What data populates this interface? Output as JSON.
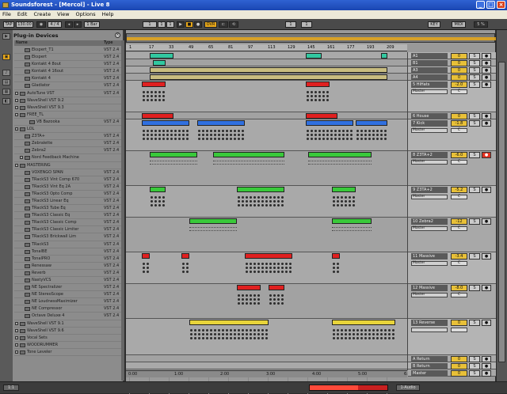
{
  "window": {
    "title": "Soundsforest - [Mercol] - Live 8",
    "buttons": [
      "_",
      "□",
      "×"
    ]
  },
  "menu": [
    "File",
    "Edit",
    "Create",
    "View",
    "Options",
    "Help"
  ],
  "toolbar": {
    "tap": "TAP",
    "tempo": "130.00",
    "sig": "4 / 4",
    "quant": "1 Bar",
    "follow": "OVR",
    "pos1": "1",
    "pos2": "1",
    "pos3": "1",
    "loop1": "1",
    "loop2": "1",
    "key": "KEY",
    "midi": "MIDI",
    "cpu": "5 %"
  },
  "browser": {
    "title": "Plug-in Devices",
    "col_name": "Name",
    "col_type": "Type",
    "icons": [
      "▶",
      "▣",
      "♪",
      "▤",
      "▦",
      "◧"
    ],
    "items": [
      {
        "name": "Ekspert_T1",
        "type": "VST 2.4",
        "kind": "plugin",
        "indent": 1
      },
      {
        "name": "Ekspert",
        "type": "VST 2.4",
        "kind": "plugin",
        "indent": 1
      },
      {
        "name": "Kontakt 4 8out",
        "type": "VST 2.4",
        "kind": "plugin",
        "indent": 1
      },
      {
        "name": "Kontakt 4 16out",
        "type": "VST 2.4",
        "kind": "plugin",
        "indent": 1
      },
      {
        "name": "Kontakt 4",
        "type": "VST 2.4",
        "kind": "plugin",
        "indent": 1
      },
      {
        "name": "Gladiator",
        "type": "VST 2.4",
        "kind": "plugin",
        "indent": 1
      },
      {
        "name": "AutoTune VST",
        "type": "VST 2.4",
        "kind": "folder",
        "indent": 0
      },
      {
        "name": "WaveShell VST 9.2",
        "type": "",
        "kind": "folder",
        "indent": 0
      },
      {
        "name": "WaveShell VST 9.3",
        "type": "",
        "kind": "folder",
        "indent": 0
      },
      {
        "name": "FREE_TL",
        "type": "",
        "kind": "folder",
        "indent": 0
      },
      {
        "name": "VB Bazooka",
        "type": "VST 2.4",
        "kind": "plugin",
        "indent": 2
      },
      {
        "name": "LOL",
        "type": "",
        "kind": "folder",
        "indent": 0
      },
      {
        "name": "Z3TA+",
        "type": "VST 2.4",
        "kind": "plugin",
        "indent": 1
      },
      {
        "name": "Zebralette",
        "type": "VST 2.4",
        "kind": "plugin",
        "indent": 1
      },
      {
        "name": "Zebra2",
        "type": "VST 2.4",
        "kind": "plugin",
        "indent": 1
      },
      {
        "name": "Nord Feedback Machine",
        "type": "",
        "kind": "folder",
        "indent": 1
      },
      {
        "name": "MASTERING",
        "type": "",
        "kind": "folder",
        "indent": 0
      },
      {
        "name": "VOXENGO SPAN",
        "type": "VST 2.4",
        "kind": "plugin",
        "indent": 1
      },
      {
        "name": "TRackS3 Vint Comp 670",
        "type": "VST 2.4",
        "kind": "plugin",
        "indent": 1
      },
      {
        "name": "TRackS3 Vint Eq 2A",
        "type": "VST 2.4",
        "kind": "plugin",
        "indent": 1
      },
      {
        "name": "TRackS3 Opto Comp",
        "type": "VST 2.4",
        "kind": "plugin",
        "indent": 1
      },
      {
        "name": "TRackS3 Linear Eq",
        "type": "VST 2.4",
        "kind": "plugin",
        "indent": 1
      },
      {
        "name": "TRackS3 Tube Eq",
        "type": "VST 2.4",
        "kind": "plugin",
        "indent": 1
      },
      {
        "name": "TRackS3 Classic Eq",
        "type": "VST 2.4",
        "kind": "plugin",
        "indent": 1
      },
      {
        "name": "TRackS3 Classic Comp",
        "type": "VST 2.4",
        "kind": "plugin",
        "indent": 1
      },
      {
        "name": "TRackS3 Classic Limiter",
        "type": "VST 2.4",
        "kind": "plugin",
        "indent": 1
      },
      {
        "name": "TRackS3 Brickwall Lim",
        "type": "VST 2.4",
        "kind": "plugin",
        "indent": 1
      },
      {
        "name": "TRackS3",
        "type": "VST 2.4",
        "kind": "plugin",
        "indent": 1
      },
      {
        "name": "TonalBE",
        "type": "VST 2.4",
        "kind": "plugin",
        "indent": 1
      },
      {
        "name": "TonalPRO",
        "type": "VST 2.4",
        "kind": "plugin",
        "indent": 1
      },
      {
        "name": "Renessaw",
        "type": "VST 2.4",
        "kind": "plugin",
        "indent": 1
      },
      {
        "name": "Reverb",
        "type": "VST 2.4",
        "kind": "plugin",
        "indent": 1
      },
      {
        "name": "NastyVCS",
        "type": "VST 2.4",
        "kind": "plugin",
        "indent": 1
      },
      {
        "name": "NE Spectralizer",
        "type": "VST 2.4",
        "kind": "plugin",
        "indent": 1
      },
      {
        "name": "NE StereoScope",
        "type": "VST 2.4",
        "kind": "plugin",
        "indent": 1
      },
      {
        "name": "NE LoudnessMaximizer",
        "type": "VST 2.4",
        "kind": "plugin",
        "indent": 1
      },
      {
        "name": "NE Compressor",
        "type": "VST 2.4",
        "kind": "plugin",
        "indent": 1
      },
      {
        "name": "Octave Deluxe 4",
        "type": "VST 2.4",
        "kind": "plugin",
        "indent": 1
      },
      {
        "name": "WaveShell VST 9.1",
        "type": "",
        "kind": "folder",
        "indent": 0
      },
      {
        "name": "WaveShell VST 9.6",
        "type": "",
        "kind": "folder",
        "indent": 0
      },
      {
        "name": "Vocal Sets",
        "type": "",
        "kind": "folder",
        "indent": 0
      },
      {
        "name": "WOODRUMMER",
        "type": "",
        "kind": "folder",
        "indent": 0
      },
      {
        "name": "Tone Leveler",
        "type": "",
        "kind": "folder",
        "indent": 0
      }
    ]
  },
  "ruler": [
    "1",
    "17",
    "33",
    "49",
    "65",
    "81",
    "97",
    "113",
    "129",
    "145",
    "161",
    "177",
    "193",
    "209"
  ],
  "timeline": [
    "0:00",
    "1:00",
    "2:00",
    "3:00",
    "4:00",
    "5:00",
    "6:00"
  ],
  "tracks": [
    {
      "name": "A1",
      "io": "",
      "vol": "0",
      "pan": "",
      "arm": false
    },
    {
      "name": "B1",
      "io": "",
      "vol": "0",
      "pan": "",
      "arm": false
    },
    {
      "name": "A3",
      "io": "",
      "vol": "0",
      "pan": "",
      "arm": false
    },
    {
      "name": "A4",
      "io": "",
      "vol": "0",
      "pan": "",
      "arm": false
    },
    {
      "name": "5 HiHats",
      "io": "Master",
      "vol": "-2.0",
      "pan": "C",
      "arm": false
    },
    {
      "name": "6 House",
      "io": "",
      "vol": "0",
      "pan": "",
      "arm": false
    },
    {
      "name": "7 Kick",
      "io": "Master",
      "vol": "-1.8",
      "pan": "C",
      "arm": false
    },
    {
      "name": "8 Z3TA+2",
      "io": "Master",
      "vol": "-6.0",
      "pan": "C",
      "arm": true
    },
    {
      "name": "9 Z3TA+2",
      "io": "Master",
      "vol": "-5.2",
      "pan": "C",
      "arm": false
    },
    {
      "name": "10 Zebra2",
      "io": "Master",
      "vol": "-12",
      "pan": "C",
      "arm": false
    },
    {
      "name": "11 Massive",
      "io": "Master",
      "vol": "-3.4",
      "pan": "C",
      "arm": false
    },
    {
      "name": "12 Massive",
      "io": "Master",
      "vol": "-8.0",
      "pan": "C",
      "arm": false
    },
    {
      "name": "13 Reverse",
      "io": "",
      "vol": "0",
      "pan": "",
      "arm": false
    },
    {
      "name": "A Return",
      "io": "",
      "vol": "0",
      "pan": "",
      "arm": false
    },
    {
      "name": "B Return",
      "io": "",
      "vol": "0",
      "pan": "",
      "arm": false
    },
    {
      "name": "Master",
      "io": "",
      "vol": "0",
      "pan": "",
      "arm": false
    }
  ],
  "status": {
    "left": "1:1",
    "cpu_pct": 0.62,
    "right": "1-Audio"
  }
}
